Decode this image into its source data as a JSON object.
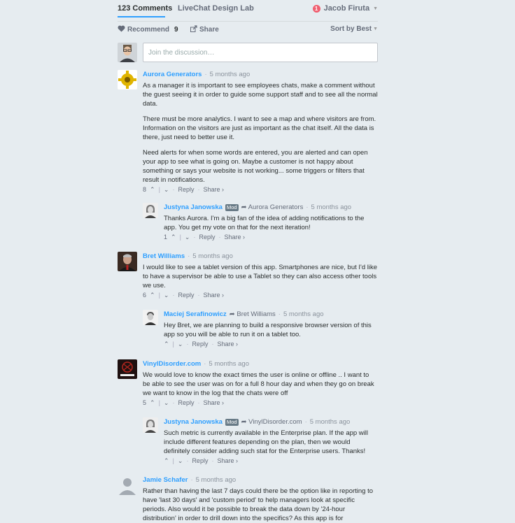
{
  "nav": {
    "comments_count": "123",
    "comments_label": "Comments",
    "forum_name": "LiveChat Design Lab",
    "notifications": "1",
    "user_name": "Jacob Firuta"
  },
  "toolbar": {
    "recommend_label": "Recommend",
    "recommend_count": "9",
    "share_label": "Share",
    "sort_label": "Sort by Best"
  },
  "compose": {
    "placeholder": "Join the discussion…"
  },
  "comments": [
    {
      "author": "Aurora Generators",
      "time": "5 months ago",
      "paragraphs": [
        "As a manager it is important to see employees chats, make a comment without the guest seeing it in order to guide some support staff and to see all the normal data.",
        "There must be more analytics. I want to see a map and where visitors are from. Information on the visitors are just as important as the chat itself. All the data is there, just need to better use it.",
        "Need alerts for when some words are entered, you are alerted and can open your app to see what is going on. Maybe a customer is not happy about something or says your website is not working... some triggers or filters that result in notifications."
      ],
      "votes": "8",
      "reply": "Reply",
      "share": "Share ›"
    },
    {
      "author": "Justyna Janowska",
      "mod": "Mod",
      "reply_to": "Aurora Generators",
      "time": "5 months ago",
      "paragraphs": [
        "Thanks Aurora. I'm a big fan of the idea of adding notifications to the app. You get my vote on that for the next iteration!"
      ],
      "votes": "1",
      "reply": "Reply",
      "share": "Share ›"
    },
    {
      "author": "Bret Williams",
      "time": "5 months ago",
      "paragraphs": [
        "I would like to see a tablet version of this app. Smartphones are nice, but I'd like to have a supervisor be able to use a Tablet so they can also access other tools we use."
      ],
      "votes": "6",
      "reply": "Reply",
      "share": "Share ›"
    },
    {
      "author": "Maciej Serafinowicz",
      "reply_to": "Bret Williams",
      "time": "5 months ago",
      "paragraphs": [
        "Hey Bret, we are planning to build a responsive browser version of this app so you will be able to run it on a tablet too."
      ],
      "votes": "",
      "reply": "Reply",
      "share": "Share ›"
    },
    {
      "author": "VinylDisorder.com",
      "time": "5 months ago",
      "paragraphs": [
        "We would love to know the exact times the user is online or offline .. I want to be able to see the user was on for a full 8 hour day and when they go on break we want to know in the log that the chats were off"
      ],
      "votes": "5",
      "reply": "Reply",
      "share": "Share ›"
    },
    {
      "author": "Justyna Janowska",
      "mod": "Mod",
      "reply_to": "VinylDisorder.com",
      "time": "5 months ago",
      "paragraphs": [
        "Such metric is currently available in the Enterprise plan. If the app will include different features depending on the plan, then we would definitely consider adding such stat for the Enterprise users. Thanks!"
      ],
      "votes": "",
      "reply": "Reply",
      "share": "Share ›"
    },
    {
      "author": "Jamie Schafer",
      "time": "5 months ago",
      "paragraphs": [
        "Rather than having the last 7 days could there be the option like in reporting to have 'last 30 days' and 'custom period' to help managers look at specific periods. Also would it be possible to break the data down by '24-hour distribution' in order to drill down into the specifics? As this app is for"
      ],
      "votes": "",
      "reply": "",
      "share": ""
    }
  ],
  "colors": {
    "accent": "#2e9fff",
    "background": "#e6ecf0",
    "mod_badge": "#687a86"
  }
}
